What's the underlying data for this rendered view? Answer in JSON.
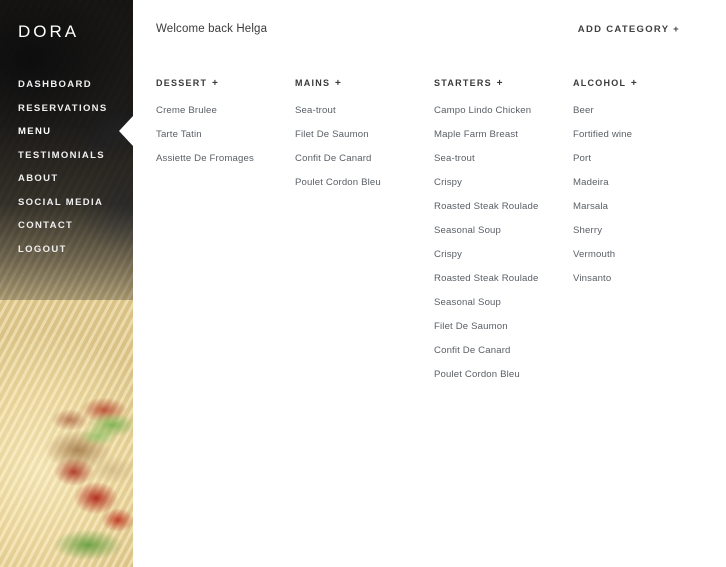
{
  "sidebar": {
    "brand": "DORA",
    "active_item": "MENU",
    "items": [
      {
        "label": "DASHBOARD"
      },
      {
        "label": "RESERVATIONS"
      },
      {
        "label": "MENU"
      },
      {
        "label": "TESTIMONIALS"
      },
      {
        "label": "ABOUT"
      },
      {
        "label": "SOCIAL MEDIA"
      },
      {
        "label": "CONTACT"
      },
      {
        "label": "LOGOUT"
      }
    ]
  },
  "header": {
    "welcome": "Welcome back Helga",
    "add_category": "ADD CATEGORY +"
  },
  "columns": [
    {
      "title": "DESSERT",
      "add_glyph": "+",
      "items": [
        "Creme Brulee",
        "Tarte Tatin",
        "Assiette De Fromages"
      ]
    },
    {
      "title": "MAINS",
      "add_glyph": "+",
      "items": [
        "Sea-trout",
        "Filet De Saumon",
        "Confit De Canard",
        "Poulet Cordon Bleu"
      ]
    },
    {
      "title": "STARTERS",
      "add_glyph": "+",
      "items": [
        "Campo Lindo Chicken",
        "Maple Farm Breast",
        "Sea-trout",
        "Crispy",
        "Roasted Steak Roulade",
        "Seasonal Soup",
        "Crispy",
        "Roasted Steak Roulade",
        "Seasonal Soup",
        "Filet De Saumon",
        "Confit De Canard",
        "Poulet Cordon Bleu"
      ]
    },
    {
      "title": "ALCOHOL",
      "add_glyph": "+",
      "items": [
        "Beer",
        "Fortified wine",
        "Port",
        "Madeira",
        "Marsala",
        "Sherry",
        "Vermouth",
        "Vinsanto"
      ]
    }
  ],
  "colors": {
    "sidebar_background": "#121213",
    "content_background": "#ffffff",
    "brand_text": "#ffffff",
    "nav_text": "#f0f0f0",
    "heading_text": "#3a3a3a",
    "item_text": "#5a5f66",
    "active_pointer": "#ffffff"
  }
}
